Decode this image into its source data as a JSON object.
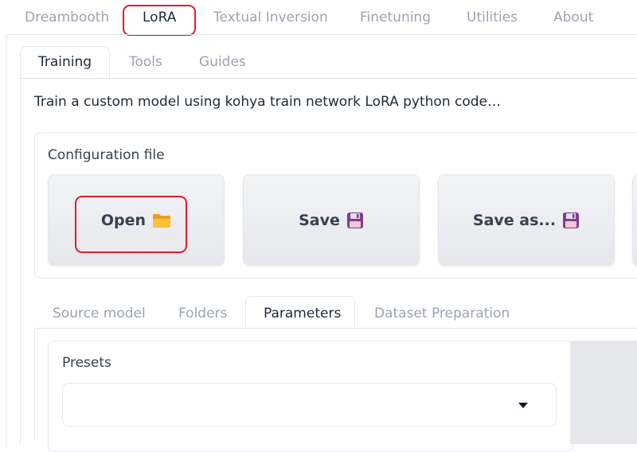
{
  "top_tabs": [
    {
      "label": "Dreambooth"
    },
    {
      "label": "LoRA"
    },
    {
      "label": "Textual Inversion"
    },
    {
      "label": "Finetuning"
    },
    {
      "label": "Utilities"
    },
    {
      "label": "About"
    }
  ],
  "sub_tabs": [
    {
      "label": "Training"
    },
    {
      "label": "Tools"
    },
    {
      "label": "Guides"
    }
  ],
  "description": "Train a custom model using kohya train network LoRA python code…",
  "config": {
    "label": "Configuration file",
    "open_label": "Open",
    "save_label": "Save",
    "save_as_label": "Save as...",
    "open_icon": "folder-icon",
    "save_icon": "floppy-disk-icon"
  },
  "lower_tabs": [
    {
      "label": "Source model"
    },
    {
      "label": "Folders"
    },
    {
      "label": "Parameters"
    },
    {
      "label": "Dataset Preparation"
    }
  ],
  "presets": {
    "label": "Presets",
    "value": ""
  },
  "colors": {
    "highlight": "#e11d2e",
    "folder": "#f5b72a",
    "floppy": "#7b3f8c"
  }
}
